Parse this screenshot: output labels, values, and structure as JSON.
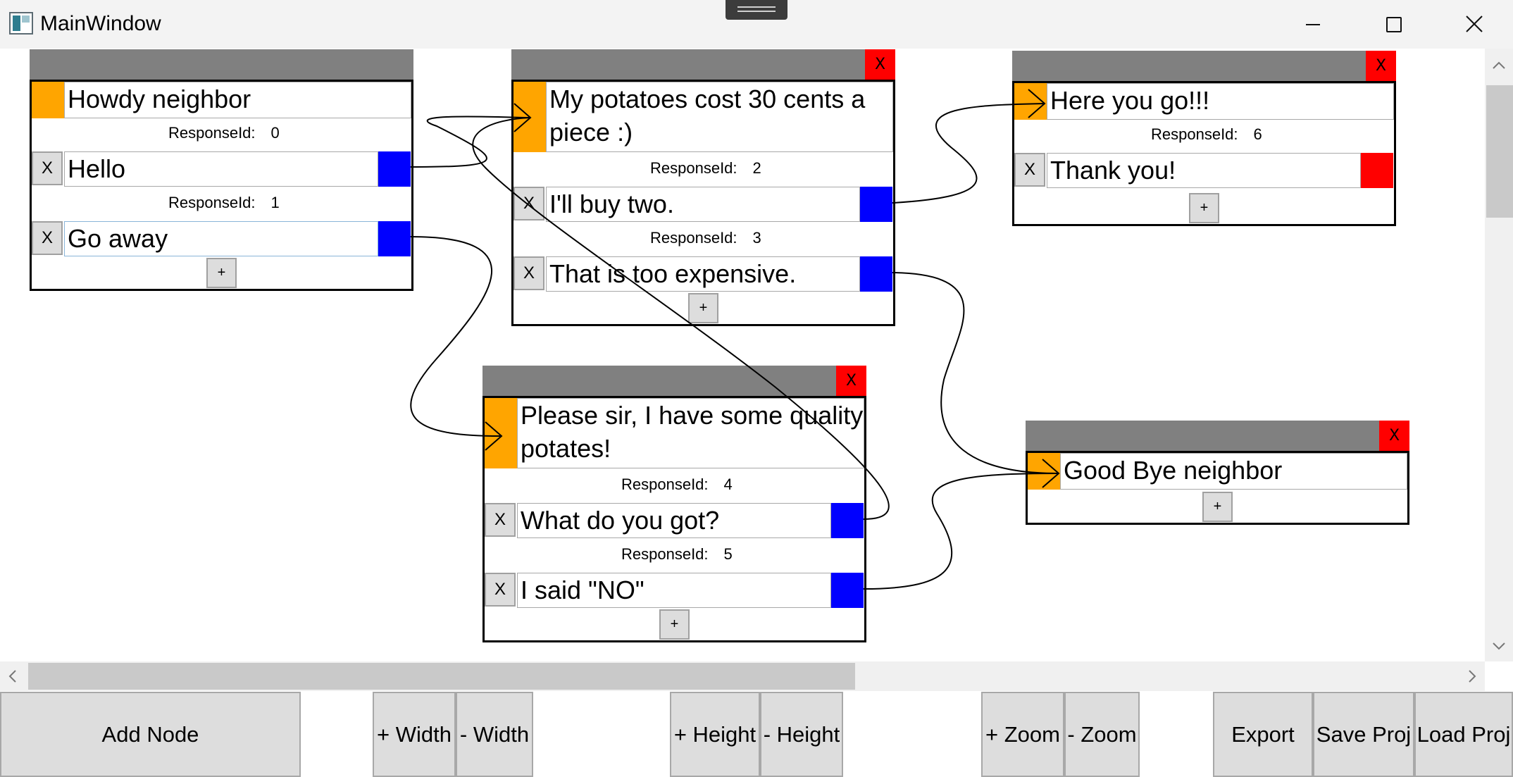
{
  "window": {
    "title": "MainWindow"
  },
  "nodes": [
    {
      "id": "node-howdy",
      "prompt": "Howdy neighbor",
      "has_close": false,
      "responses": [
        {
          "id_label": "ResponseId:",
          "id_value": "0",
          "delete_label": "X",
          "text": "Hello",
          "port_color": "#0000ff"
        },
        {
          "id_label": "ResponseId:",
          "id_value": "1",
          "delete_label": "X",
          "text": "Go away",
          "port_color": "#0000ff"
        }
      ],
      "add_label": "+"
    },
    {
      "id": "node-potatoes",
      "prompt": "My potatoes cost 30 cents a piece :)",
      "has_close": true,
      "close_label": "X",
      "responses": [
        {
          "id_label": "ResponseId:",
          "id_value": "2",
          "delete_label": "X",
          "text": "I'll buy two.",
          "port_color": "#0000ff"
        },
        {
          "id_label": "ResponseId:",
          "id_value": "3",
          "delete_label": "X",
          "text": "That is too expensive.",
          "port_color": "#0000ff"
        }
      ],
      "add_label": "+"
    },
    {
      "id": "node-here-you-go",
      "prompt": "Here you go!!!",
      "has_close": true,
      "close_label": "X",
      "responses": [
        {
          "id_label": "ResponseId:",
          "id_value": "6",
          "delete_label": "X",
          "text": "Thank you!",
          "port_color": "#ff0000"
        }
      ],
      "add_label": "+"
    },
    {
      "id": "node-please-sir",
      "prompt": "Please sir, I have some quality potates!",
      "has_close": true,
      "close_label": "X",
      "responses": [
        {
          "id_label": "ResponseId:",
          "id_value": "4",
          "delete_label": "X",
          "text": "What do you got?",
          "port_color": "#0000ff"
        },
        {
          "id_label": "ResponseId:",
          "id_value": "5",
          "delete_label": "X",
          "text": "I said \"NO\"",
          "port_color": "#0000ff"
        }
      ],
      "add_label": "+"
    },
    {
      "id": "node-good-bye",
      "prompt": "Good Bye neighbor",
      "has_close": true,
      "close_label": "X",
      "responses": [],
      "add_label": "+"
    }
  ],
  "toolbar": {
    "add_node": "Add Node",
    "width_plus": "+ Width",
    "width_minus": "- Width",
    "height_plus": "+ Height",
    "height_minus": "- Height",
    "zoom_plus": "+ Zoom",
    "zoom_minus": "- Zoom",
    "export": "Export",
    "save_proj": "Save Proj",
    "load_proj": "Load Proj"
  },
  "colors": {
    "node_header": "#808080",
    "input_port": "#ffa500",
    "output_port": "#0000ff",
    "close_button": "#ff0000",
    "unlinked_port": "#ff0000"
  }
}
